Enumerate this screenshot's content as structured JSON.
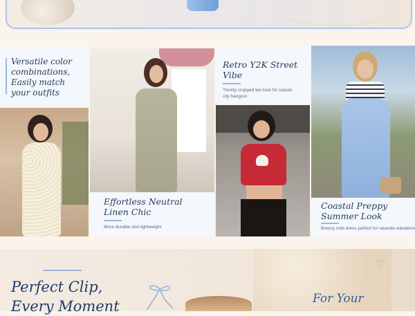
{
  "colors": {
    "page_bg": "#fbf4ec",
    "accent_blue": "#a9c6e8",
    "heading_navy": "#1f3d66"
  },
  "collage": {
    "versatile": {
      "text": "Versatile color combinations, Easily match your outfits"
    },
    "retro": {
      "title": "Retro Y2K Street Vibe",
      "subtitle": "Trendy cropped tee look for casual city hangout"
    },
    "linen": {
      "title": "Effortless Neutral Linen Chic",
      "subtitle": "More durable and lightweight"
    },
    "coastal": {
      "title": "Coastal Preppy Summer Look",
      "subtitle": "Breezy midi dress perfect for seaside wandering"
    }
  },
  "bottom": {
    "headline_line1": "Perfect Clip,",
    "headline_line2": "Every Moment",
    "script": "For Your"
  }
}
